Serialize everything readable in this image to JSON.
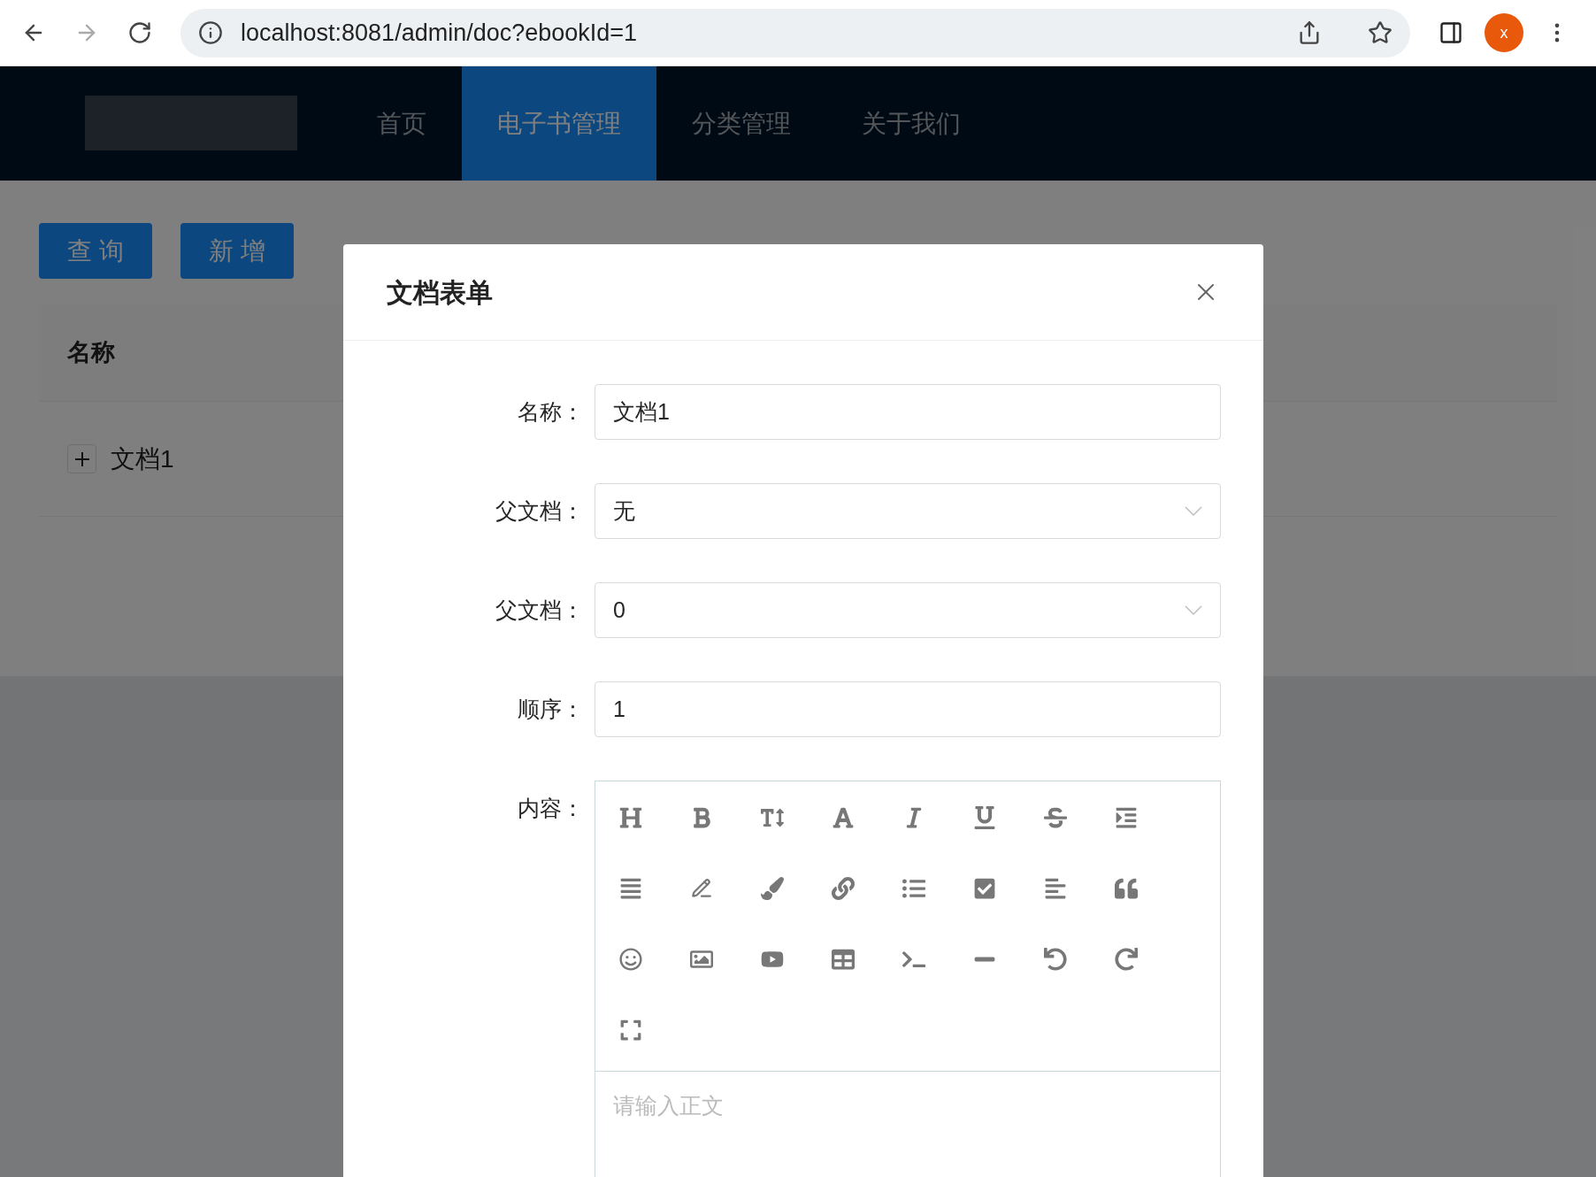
{
  "browser": {
    "url": "localhost:8081/admin/doc?ebookId=1",
    "profile_initial": "x"
  },
  "nav": {
    "items": [
      {
        "label": "首页",
        "selected": false
      },
      {
        "label": "电子书管理",
        "selected": true
      },
      {
        "label": "分类管理",
        "selected": false
      },
      {
        "label": "关于我们",
        "selected": false
      }
    ]
  },
  "actions": [
    "查 询",
    "新 增"
  ],
  "table": {
    "columns": [
      "名称"
    ],
    "rows": [
      {
        "name": "文档1",
        "expanded": false
      }
    ]
  },
  "modal": {
    "title": "文档表单",
    "fields": [
      {
        "kind": "input",
        "label": "名称：",
        "value": "文档1"
      },
      {
        "kind": "select",
        "label": "父文档：",
        "value": "无"
      },
      {
        "kind": "select",
        "label": "父文档：",
        "value": "0"
      },
      {
        "kind": "input",
        "label": "顺序：",
        "value": "1"
      },
      {
        "kind": "editor",
        "label": "内容：",
        "placeholder": "请输入正文"
      }
    ]
  }
}
